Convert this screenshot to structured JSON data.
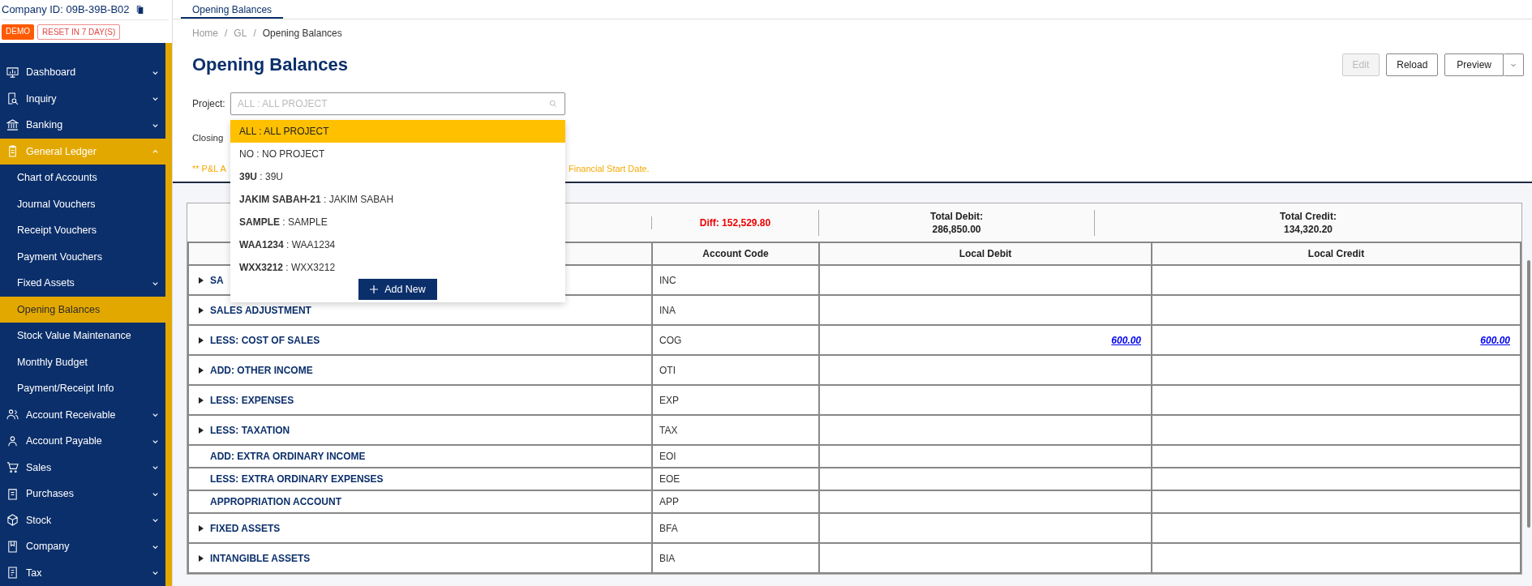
{
  "company": {
    "id_label": "Company ID: 09B-39B-B02",
    "badges": [
      {
        "kind": "solid",
        "label": "DEMO"
      },
      {
        "kind": "outline",
        "label": "RESET IN 7 DAY(S)"
      }
    ]
  },
  "sidebar": {
    "items": [
      {
        "label": "Dashboard",
        "selected": false,
        "expanded": false
      },
      {
        "label": "Inquiry",
        "selected": false,
        "expanded": false
      },
      {
        "label": "Banking",
        "selected": false,
        "expanded": false
      },
      {
        "label": "General Ledger",
        "selected": false,
        "expanded": true,
        "children": [
          {
            "label": "Chart of Accounts",
            "selected": false
          },
          {
            "label": "Journal Vouchers",
            "selected": false
          },
          {
            "label": "Receipt Vouchers",
            "selected": false
          },
          {
            "label": "Payment Vouchers",
            "selected": false
          },
          {
            "label": "Fixed Assets",
            "selected": false,
            "expanded": false
          },
          {
            "label": "Opening Balances",
            "selected": true
          },
          {
            "label": "Stock Value Maintenance",
            "selected": false
          },
          {
            "label": "Monthly Budget",
            "selected": false
          },
          {
            "label": "Payment/Receipt Info",
            "selected": false
          }
        ]
      },
      {
        "label": "Account Receivable",
        "selected": false,
        "expanded": false
      },
      {
        "label": "Account Payable",
        "selected": false,
        "expanded": false
      },
      {
        "label": "Sales",
        "selected": false,
        "expanded": false
      },
      {
        "label": "Purchases",
        "selected": false,
        "expanded": false
      },
      {
        "label": "Stock",
        "selected": false,
        "expanded": false
      },
      {
        "label": "Company",
        "selected": false,
        "expanded": false
      },
      {
        "label": "Tax",
        "selected": false,
        "expanded": false
      }
    ]
  },
  "tabs": [
    {
      "label": "Opening Balances",
      "selected": true
    }
  ],
  "breadcrumb": [
    "Home",
    "GL",
    "Opening Balances"
  ],
  "breadcrumb_separator": "/",
  "title": "Opening Balances",
  "buttons": [
    {
      "label": "Edit",
      "disabled": true
    },
    {
      "label": "Reload",
      "disabled": false
    }
  ],
  "preview_button": {
    "label": "Preview"
  },
  "project": {
    "label": "Project:",
    "placeholder": "ALL : ALL PROJECT"
  },
  "project_dropdown": {
    "options": [
      {
        "text": "ALL : ALL PROJECT",
        "selected": true
      },
      {
        "text": "NO : NO PROJECT",
        "selected": false
      },
      {
        "text": "**39U** : 39U",
        "selected": false
      },
      {
        "text": "**JAKIM SABAH-21** : JAKIM SABAH",
        "selected": false
      },
      {
        "text": "**SAMPLE** : SAMPLE",
        "selected": false
      },
      {
        "text": "**WAA1234** : WAA1234",
        "selected": false
      },
      {
        "text": "**WXX3212** : WXX3212",
        "selected": false
      }
    ],
    "add_button": "Add New"
  },
  "closing_label": "Closing",
  "notice": {
    "start": "** P&L A",
    "end": "Financial Start Date."
  },
  "totals": {
    "diff": "Diff: 152,529.80",
    "debit_label": "Total Debit:",
    "debit": "286,850.00",
    "credit_label": "Total Credit:",
    "credit": "134,320.20"
  },
  "table": {
    "columns": [
      "Account Code",
      "Local Debit",
      "Local Credit"
    ],
    "rows": [
      {
        "name": "SA",
        "code": "INC",
        "expandable": true
      },
      {
        "name": "SALES ADJUSTMENT",
        "code": "INA",
        "expandable": true
      },
      {
        "name": "LESS: COST OF SALES",
        "code": "COG",
        "debit": "600.00",
        "credit": "600.00",
        "expandable": true
      },
      {
        "name": "ADD: OTHER INCOME",
        "code": "OTI",
        "expandable": true
      },
      {
        "name": "LESS: EXPENSES",
        "code": "EXP",
        "expandable": true
      },
      {
        "name": "LESS: TAXATION",
        "code": "TAX",
        "expandable": true
      },
      {
        "name": "ADD: EXTRA ORDINARY INCOME",
        "code": "EOI",
        "expandable": false
      },
      {
        "name": "LESS: EXTRA ORDINARY EXPENSES",
        "code": "EOE",
        "expandable": false
      },
      {
        "name": "APPROPRIATION ACCOUNT",
        "code": "APP",
        "expandable": false
      },
      {
        "name": "FIXED ASSETS",
        "code": "BFA",
        "expandable": true
      },
      {
        "name": "INTANGIBLE ASSETS",
        "code": "BIA",
        "expandable": true
      }
    ]
  }
}
